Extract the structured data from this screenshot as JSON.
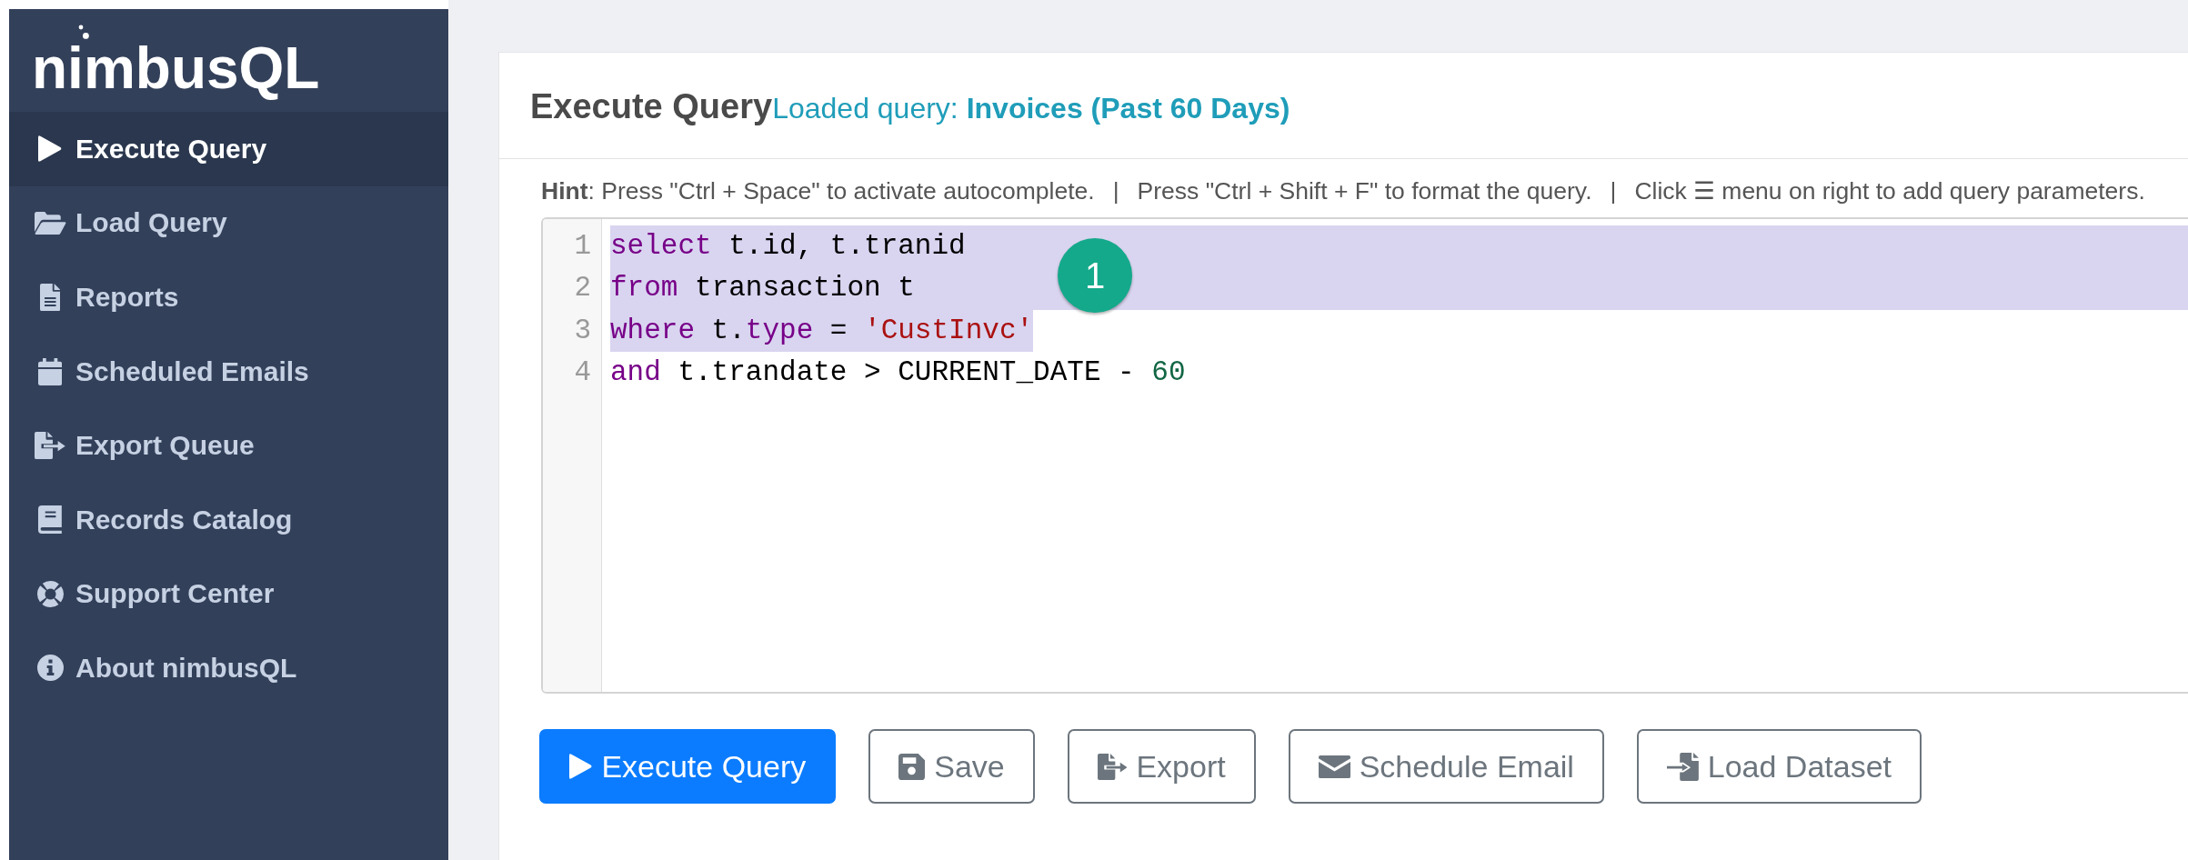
{
  "sidebar": {
    "logo": "nimbusQL",
    "items": [
      {
        "label": "Execute Query",
        "selected": true
      },
      {
        "label": "Load Query",
        "selected": false
      },
      {
        "label": "Reports",
        "selected": false
      },
      {
        "label": "Scheduled Emails",
        "selected": false
      },
      {
        "label": "Export Queue",
        "selected": false
      },
      {
        "label": "Records Catalog",
        "selected": false
      },
      {
        "label": "Support Center",
        "selected": false
      },
      {
        "label": "About nimbusQL",
        "selected": false
      }
    ]
  },
  "header": {
    "title": "Execute Query",
    "subtitle": "Loaded query: **Invoices (Past 60 Days)**"
  },
  "hint": {
    "parts": [
      {
        "kind": "tip",
        "text": "**Hint**: Press \"Ctrl + Space\" to activate autocomplete."
      },
      {
        "kind": "separator",
        "text": "|"
      },
      {
        "kind": "tip",
        "text": "Press \"Ctrl + Shift + F\" to format the query."
      },
      {
        "kind": "separator",
        "text": "|"
      },
      {
        "kind": "tip",
        "text": "Click ☰ menu on right to add query parameters."
      }
    ]
  },
  "editor": {
    "lines": [
      {
        "number": "1",
        "selected": true,
        "tokens": [
          {
            "kind": "keyword",
            "text": "select"
          },
          {
            "kind": "plain",
            "text": " t.id, t.tranid"
          }
        ]
      },
      {
        "number": "2",
        "selected": true,
        "tokens": [
          {
            "kind": "keyword",
            "text": "from"
          },
          {
            "kind": "plain",
            "text": " transaction t"
          }
        ]
      },
      {
        "number": "3",
        "selected": true,
        "tokens": [
          {
            "kind": "keyword",
            "text": "where"
          },
          {
            "kind": "plain",
            "text": " t."
          },
          {
            "kind": "keyword",
            "text": "type"
          },
          {
            "kind": "plain",
            "text": " = "
          },
          {
            "kind": "string",
            "text": "'CustInvc'"
          }
        ]
      },
      {
        "number": "4",
        "selected": false,
        "tokens": [
          {
            "kind": "keyword",
            "text": "and"
          },
          {
            "kind": "plain",
            "text": " t.trandate > CURRENT_DATE - "
          },
          {
            "kind": "number",
            "text": "60"
          }
        ]
      }
    ],
    "callout": {
      "text": "1"
    }
  },
  "buttons": [
    {
      "label": "Execute Query",
      "kind": "primary"
    },
    {
      "label": "Save",
      "kind": "secondary"
    },
    {
      "label": "Export",
      "kind": "secondary"
    },
    {
      "label": "Schedule Email",
      "kind": "secondary"
    },
    {
      "label": "Load Dataset",
      "kind": "secondary"
    }
  ]
}
